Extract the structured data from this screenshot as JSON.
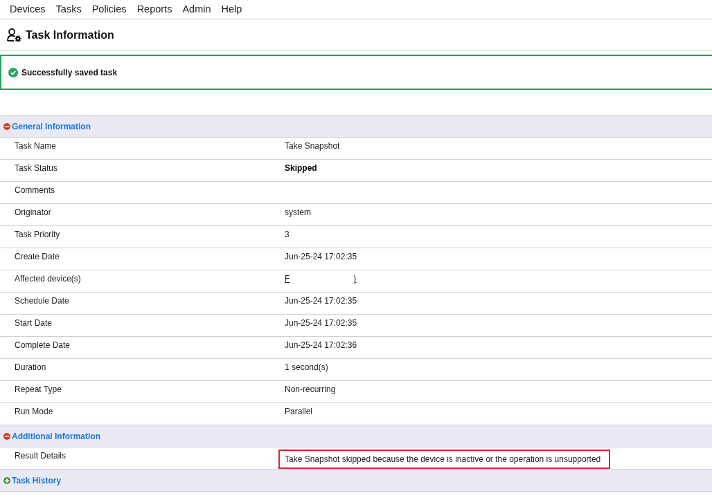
{
  "menu": [
    "Devices",
    "Tasks",
    "Policies",
    "Reports",
    "Admin",
    "Help"
  ],
  "page_title": "Task Information",
  "alert": {
    "kind": "success",
    "message": "Successfully saved task"
  },
  "sections": [
    {
      "title": "General Information",
      "expanded": true,
      "rows": [
        {
          "label": "Task Name",
          "kind": "text",
          "value": "Take Snapshot"
        },
        {
          "label": "Task Status",
          "kind": "bold",
          "value": "Skipped"
        },
        {
          "label": "Comments",
          "kind": "empty"
        },
        {
          "label": "Originator",
          "kind": "text",
          "value": "system"
        },
        {
          "label": "Task Priority",
          "kind": "text",
          "value": "3"
        },
        {
          "label": "Create Date",
          "kind": "text",
          "value": "Jun-25-24 17:02:35"
        },
        {
          "label": "Affected device(s)",
          "kind": "redacted",
          "value_start": "F",
          "value_end": ")"
        },
        {
          "label": "Schedule Date",
          "kind": "text",
          "value": "Jun-25-24 17:02:35"
        },
        {
          "label": "Start Date",
          "kind": "text",
          "value": "Jun-25-24 17:02:35"
        },
        {
          "label": "Complete Date",
          "kind": "text",
          "value": "Jun-25-24 17:02:36"
        },
        {
          "label": "Duration",
          "kind": "text",
          "value": "1 second(s)"
        },
        {
          "label": "Repeat Type",
          "kind": "text",
          "value": "Non-recurring"
        },
        {
          "label": "Run Mode",
          "kind": "text",
          "value": "Parallel"
        }
      ]
    },
    {
      "title": "Additional Information",
      "expanded": true,
      "rows": [
        {
          "label": "Result Details",
          "kind": "highlighted",
          "value": "Take Snapshot skipped because the device is inactive or the operation is unsupported"
        }
      ]
    },
    {
      "title": "Task History",
      "expanded": false
    }
  ]
}
